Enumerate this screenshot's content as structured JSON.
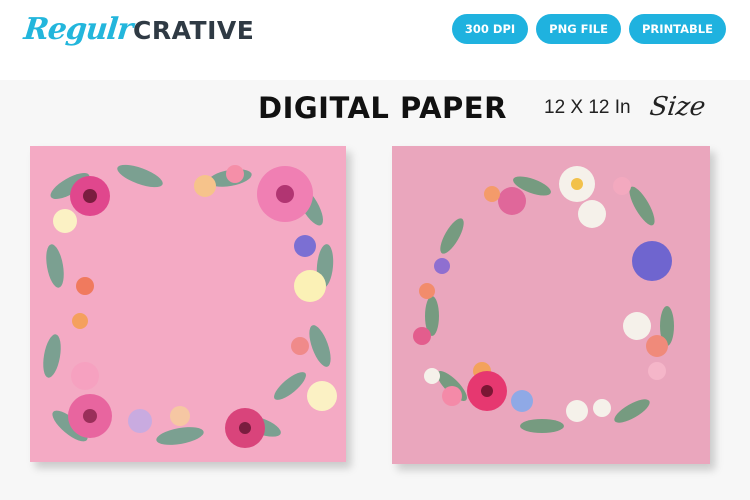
{
  "brand": {
    "script": "Regulr",
    "block": "CRATIVE"
  },
  "badges": [
    "300 DPI",
    "PNG FILE",
    "PRINTABLE"
  ],
  "title": "DIGITAL PAPER",
  "size": {
    "value": "12 X 12 In",
    "script": "Size"
  },
  "colors": {
    "accent": "#1fb2df",
    "logo_script": "#23b6dc",
    "logo_block": "#2f3a44",
    "paper_pink": "#f4aac4",
    "leaf_green": "#6fa08c"
  },
  "papers": [
    {
      "name": "square-floral-frame"
    },
    {
      "name": "round-floral-wreath"
    }
  ]
}
